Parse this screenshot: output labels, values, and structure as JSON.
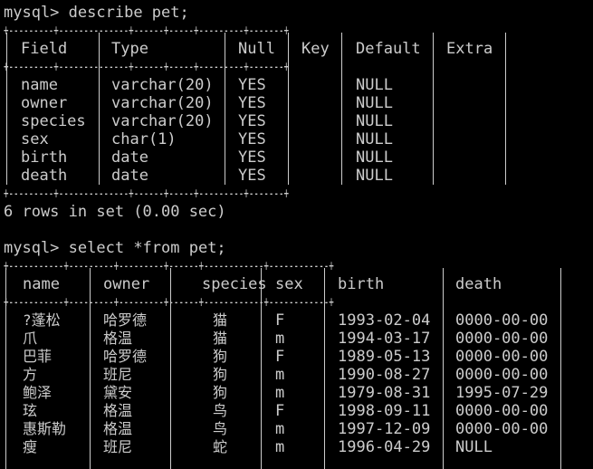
{
  "prompt": "mysql>",
  "commands": {
    "describe": "describe pet;",
    "select": "select *from pet;"
  },
  "border_describe": "+---------+--------------+------+-----+---------+-------+",
  "border_select": "+-----------+---------+---------+------+------------+------------+",
  "describe_table": {
    "headers": [
      "Field",
      "Type",
      "Null",
      "Key",
      "Default",
      "Extra"
    ],
    "rows": [
      [
        "name",
        "varchar(20)",
        "YES",
        "",
        "NULL",
        ""
      ],
      [
        "owner",
        "varchar(20)",
        "YES",
        "",
        "NULL",
        ""
      ],
      [
        "species",
        "varchar(20)",
        "YES",
        "",
        "NULL",
        ""
      ],
      [
        "sex",
        "char(1)",
        "YES",
        "",
        "NULL",
        ""
      ],
      [
        "birth",
        "date",
        "YES",
        "",
        "NULL",
        ""
      ],
      [
        "death",
        "date",
        "YES",
        "",
        "NULL",
        ""
      ]
    ]
  },
  "describe_summary": "6 rows in set (0.00 sec)",
  "select_table": {
    "headers": [
      "name",
      "owner",
      "species",
      "sex",
      "birth",
      "death"
    ],
    "rows": [
      [
        "?蓬松",
        "哈罗德",
        "猫",
        "F",
        "1993-02-04",
        "0000-00-00"
      ],
      [
        "爪",
        "格温",
        "猫",
        "m",
        "1994-03-17",
        "0000-00-00"
      ],
      [
        "巴菲",
        "哈罗德",
        "狗",
        "F",
        "1989-05-13",
        "0000-00-00"
      ],
      [
        "方",
        "班尼",
        "狗",
        "m",
        "1990-08-27",
        "0000-00-00"
      ],
      [
        "鲍泽",
        "黛安",
        "狗",
        "m",
        "1979-08-31",
        "1995-07-29"
      ],
      [
        "玹",
        "格温",
        "鸟",
        "F",
        "1998-09-11",
        "0000-00-00"
      ],
      [
        "惠斯勒",
        "格温",
        "鸟",
        "m",
        "1997-12-09",
        "0000-00-00"
      ],
      [
        "瘦",
        "班尼",
        "蛇",
        "m",
        "1996-04-29",
        "NULL"
      ]
    ]
  },
  "colors": {
    "background": "#000000",
    "text": "#cccccc"
  }
}
